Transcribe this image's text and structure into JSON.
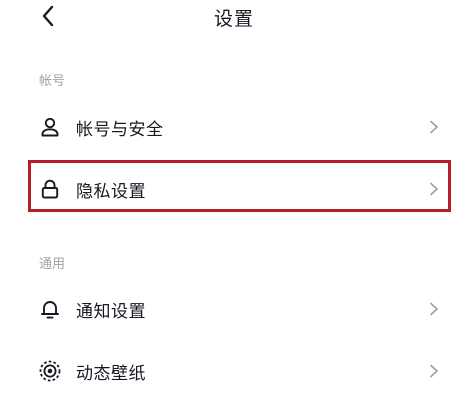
{
  "nav": {
    "title": "设置"
  },
  "sections": [
    {
      "label": "帐号",
      "items": [
        {
          "label": "帐号与安全",
          "icon": "user-icon"
        },
        {
          "label": "隐私设置",
          "icon": "lock-icon",
          "highlighted": true
        }
      ]
    },
    {
      "label": "通用",
      "items": [
        {
          "label": "通知设置",
          "icon": "bell-icon"
        },
        {
          "label": "动态壁纸",
          "icon": "live-wallpaper-icon"
        }
      ]
    }
  ],
  "colors": {
    "text": "#161823",
    "muted": "#a1a2a7",
    "highlight_border": "#b52026",
    "chevron": "#9e9fa4"
  }
}
